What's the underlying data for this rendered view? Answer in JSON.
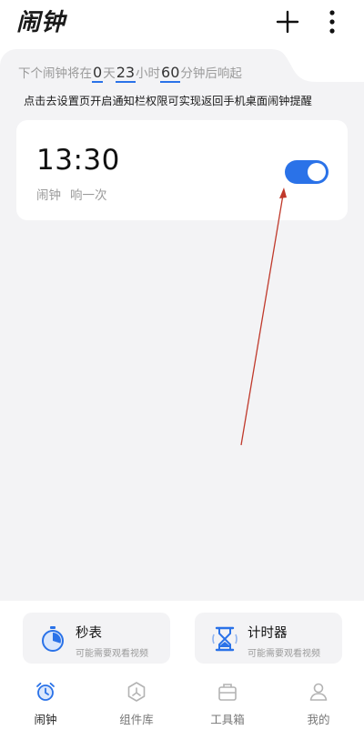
{
  "header": {
    "title": "闹钟",
    "add_icon": "plus-icon",
    "more_icon": "more-vertical-icon"
  },
  "countdown": {
    "prefix": "下个闹钟将在",
    "days": "0",
    "days_unit": "天",
    "hours": "23",
    "hours_unit": "小时",
    "minutes": "60",
    "suffix": "分钟后响起"
  },
  "notice": "点击去设置页开启通知栏权限可实现返回手机桌面闹钟提醒",
  "alarm": {
    "time": "13:30",
    "label": "闹钟",
    "repeat": "响一次",
    "enabled": true
  },
  "tools": [
    {
      "name": "秒表",
      "subtitle": "可能需要观看视频",
      "icon": "stopwatch-icon"
    },
    {
      "name": "计时器",
      "subtitle": "可能需要观看视频",
      "icon": "hourglass-icon"
    }
  ],
  "nav": {
    "items": [
      {
        "label": "闹钟",
        "icon": "alarm-clock-icon",
        "active": true
      },
      {
        "label": "组件库",
        "icon": "widget-icon",
        "active": false
      },
      {
        "label": "工具箱",
        "icon": "toolbox-icon",
        "active": false
      },
      {
        "label": "我的",
        "icon": "person-icon",
        "active": false
      }
    ]
  },
  "colors": {
    "accent": "#2a72e8",
    "panel": "#f3f3f5",
    "annotation_arrow": "#c0392b"
  }
}
